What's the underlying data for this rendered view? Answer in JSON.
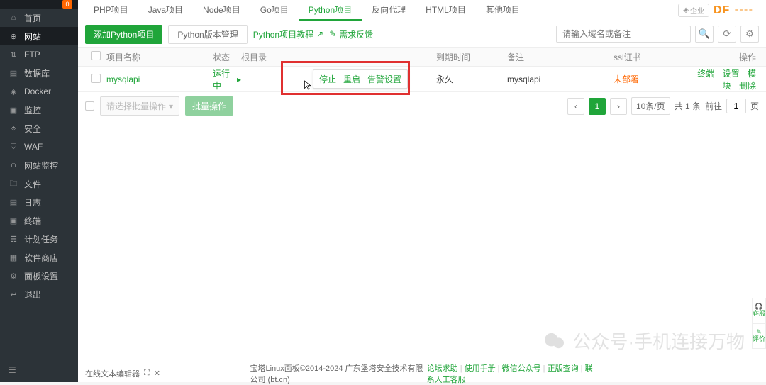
{
  "sidebar": {
    "badge": "0",
    "items": [
      {
        "icon": "⌂",
        "label": "首页",
        "name": "home"
      },
      {
        "icon": "⊕",
        "label": "网站",
        "name": "website",
        "active": true
      },
      {
        "icon": "⇅",
        "label": "FTP",
        "name": "ftp"
      },
      {
        "icon": "▤",
        "label": "数据库",
        "name": "database"
      },
      {
        "icon": "◈",
        "label": "Docker",
        "name": "docker"
      },
      {
        "icon": "▣",
        "label": "监控",
        "name": "monitor"
      },
      {
        "icon": "⛨",
        "label": "安全",
        "name": "security"
      },
      {
        "icon": "⛉",
        "label": "WAF",
        "name": "waf"
      },
      {
        "icon": "⩍",
        "label": "网站监控",
        "name": "site-monitor"
      },
      {
        "icon": "🗀",
        "label": "文件",
        "name": "files"
      },
      {
        "icon": "▤",
        "label": "日志",
        "name": "logs"
      },
      {
        "icon": "▣",
        "label": "终端",
        "name": "terminal"
      },
      {
        "icon": "☴",
        "label": "计划任务",
        "name": "cron"
      },
      {
        "icon": "▦",
        "label": "软件商店",
        "name": "store"
      },
      {
        "icon": "⚙",
        "label": "面板设置",
        "name": "settings"
      },
      {
        "icon": "↩",
        "label": "退出",
        "name": "logout"
      }
    ]
  },
  "topTabs": [
    {
      "label": "PHP项目"
    },
    {
      "label": "Java项目"
    },
    {
      "label": "Node项目"
    },
    {
      "label": "Go项目"
    },
    {
      "label": "Python项目",
      "active": true
    },
    {
      "label": "反向代理"
    },
    {
      "label": "HTML项目"
    },
    {
      "label": "其他项目"
    }
  ],
  "topRight": {
    "enterprise": "企业",
    "logo": "DF"
  },
  "toolbar": {
    "add": "添加Python项目",
    "version": "Python版本管理",
    "tutorial": "Python项目教程",
    "feedback": "需求反馈",
    "searchPlaceholder": "请输入域名或备注"
  },
  "columns": {
    "name": "项目名称",
    "status": "状态",
    "root": "根目录",
    "expire": "到期时间",
    "remark": "备注",
    "ssl": "ssl证书",
    "ops": "操作"
  },
  "row": {
    "name": "mysqlapi",
    "status": "运行中",
    "expire": "永久",
    "remark": "mysqlapi",
    "ssl": "未部署",
    "ops": {
      "terminal": "终端",
      "config": "设置",
      "module": "模块",
      "delete": "删除"
    }
  },
  "hoverMenu": {
    "stop": "停止",
    "restart": "重启",
    "loadcfg": "告警设置"
  },
  "batch": {
    "placeholder": "请选择批量操作",
    "button": "批量操作"
  },
  "pagination": {
    "size": "10条/页",
    "total": "共 1 条",
    "goto": "前往",
    "page": "1",
    "pageSuffix": "页"
  },
  "bottom": {
    "editor": "在线文本编辑器",
    "copyright": "宝塔Linux面板©2014-2024 广东堡塔安全技术有限公司 (bt.cn)",
    "links": [
      "论坛求助",
      "使用手册",
      "微信公众号",
      "正版查询",
      "联系人工客服"
    ]
  },
  "sideWidgets": {
    "service": "客服",
    "feedback": "评价"
  },
  "watermark": "公众号·手机连接万物"
}
